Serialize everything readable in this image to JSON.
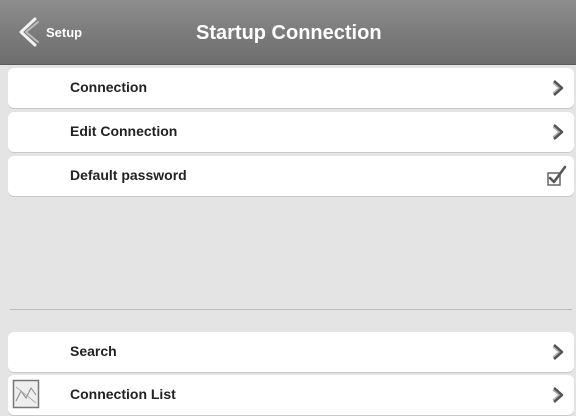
{
  "header": {
    "back_label": "Setup",
    "title": "Startup Connection",
    "back_icon": "chevron-left-icon"
  },
  "menu_top": [
    {
      "label": "Connection",
      "accessory": "chevron-right-icon"
    },
    {
      "label": "Edit Connection",
      "accessory": "chevron-right-icon"
    },
    {
      "label": "Default password",
      "accessory": "checkbox-checked-icon",
      "checked": true
    }
  ],
  "menu_bottom": [
    {
      "label": "Search",
      "accessory": "chevron-right-icon"
    },
    {
      "label": "Connection List",
      "accessory": "chevron-right-icon",
      "thumbnail": "image-thumbnail-icon"
    }
  ],
  "colors": {
    "header_bg": "#7f7f7f",
    "page_bg": "#e4e4e4",
    "row_bg": "#ffffff",
    "text": "#222222"
  }
}
